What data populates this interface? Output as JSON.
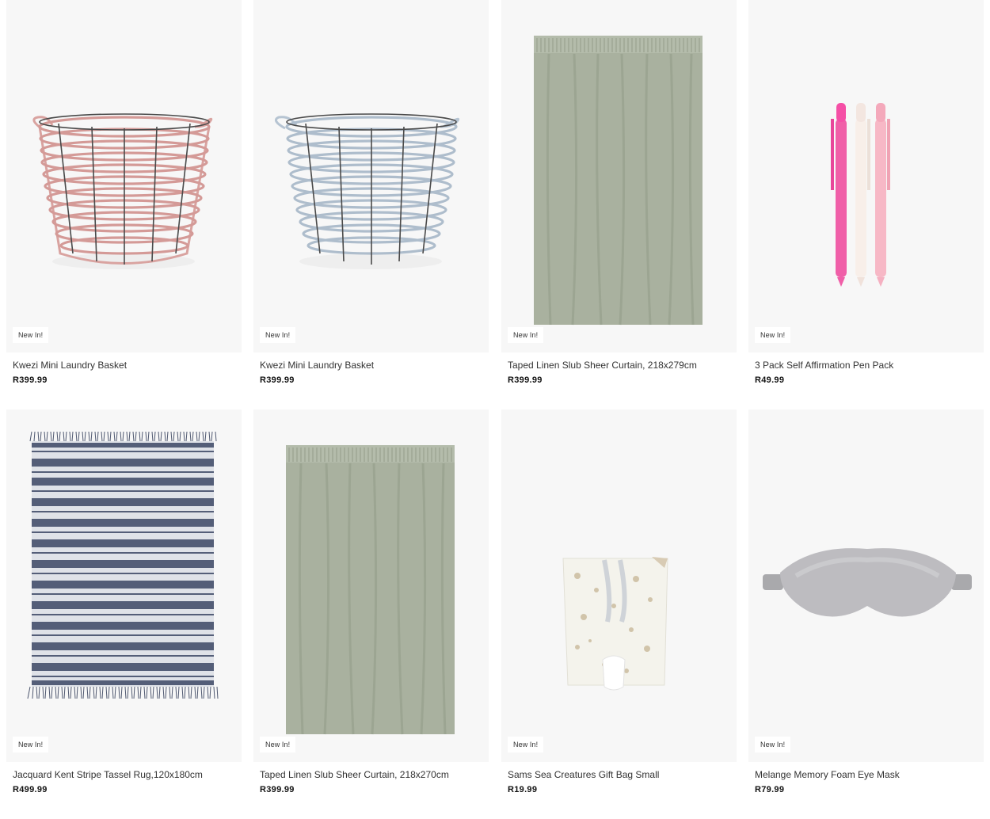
{
  "products": [
    {
      "title": "Kwezi Mini Laundry Basket",
      "price": "R399.99",
      "badge": "New In!",
      "image": "pink-wire-basket"
    },
    {
      "title": "Kwezi Mini Laundry Basket",
      "price": "R399.99",
      "badge": "New In!",
      "image": "blue-wire-basket"
    },
    {
      "title": "Taped Linen Slub Sheer Curtain, 218x279cm",
      "price": "R399.99",
      "badge": "New In!",
      "image": "sage-curtain"
    },
    {
      "title": "3 Pack Self Affirmation Pen Pack",
      "price": "R49.99",
      "badge": "New In!",
      "image": "pink-pens"
    },
    {
      "title": "Jacquard Kent Stripe Tassel Rug,120x180cm",
      "price": "R499.99",
      "badge": "New In!",
      "image": "striped-rug"
    },
    {
      "title": "Taped Linen Slub Sheer Curtain, 218x270cm",
      "price": "R399.99",
      "badge": "New In!",
      "image": "sage-curtain"
    },
    {
      "title": "Sams Sea Creatures Gift Bag Small",
      "price": "R19.99",
      "badge": "New In!",
      "image": "gift-bag"
    },
    {
      "title": "Melange Memory Foam Eye Mask",
      "price": "R79.99",
      "badge": "New In!",
      "image": "grey-eye-mask"
    }
  ]
}
